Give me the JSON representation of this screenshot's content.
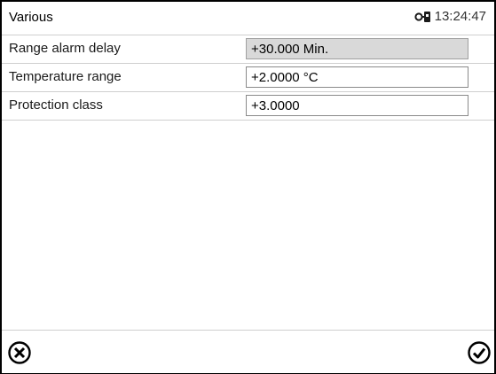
{
  "header": {
    "title": "Various",
    "time": "13:24:47",
    "status_icon": "user-key-icon"
  },
  "settings": [
    {
      "label": "Range alarm delay",
      "value": "+30.000 Min.",
      "editable": false
    },
    {
      "label": "Temperature range",
      "value": "+2.0000 °C",
      "editable": true
    },
    {
      "label": "Protection class",
      "value": "+3.0000",
      "editable": true
    }
  ],
  "footer": {
    "cancel_icon": "cancel-circle-x-icon",
    "confirm_icon": "confirm-circle-check-icon"
  }
}
